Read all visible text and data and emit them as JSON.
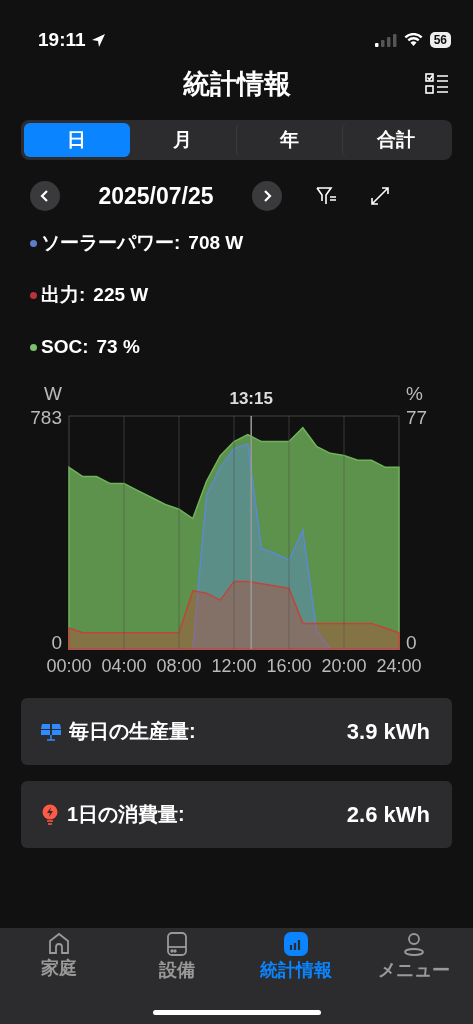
{
  "status_bar": {
    "time": "19:11",
    "battery": "56"
  },
  "header": {
    "title": "統計情報"
  },
  "period_tabs": [
    {
      "label": "日",
      "selected": true
    },
    {
      "label": "月",
      "selected": false
    },
    {
      "label": "年",
      "selected": false
    },
    {
      "label": "合計",
      "selected": false
    }
  ],
  "date_nav": {
    "date": "2025/07/25"
  },
  "legend": [
    {
      "label": "ソーラーパワー:",
      "value": "708 W",
      "color": "#5b7fc7"
    },
    {
      "label": "出力:",
      "value": "225 W",
      "color": "#b5333a"
    },
    {
      "label": "SOC:",
      "value": "73 %",
      "color": "#7cc26a"
    }
  ],
  "chart": {
    "cursor_label": "13:15",
    "left_unit": "W",
    "right_unit": "%",
    "left_ticks": [
      "783",
      "0"
    ],
    "right_ticks": [
      "77",
      "0"
    ],
    "x_labels": [
      "00:00",
      "04:00",
      "08:00",
      "12:00",
      "16:00",
      "20:00",
      "24:00"
    ]
  },
  "summary": [
    {
      "kind": "production",
      "label": "毎日の生産量:",
      "value": "3.9 kWh"
    },
    {
      "kind": "consumption",
      "label": "1日の消費量:",
      "value": "2.6 kWh"
    }
  ],
  "tab_bar": [
    {
      "kind": "home",
      "label": "家庭",
      "selected": false
    },
    {
      "kind": "device",
      "label": "設備",
      "selected": false
    },
    {
      "kind": "stats",
      "label": "統計情報",
      "selected": true
    },
    {
      "kind": "menu",
      "label": "メニュー",
      "selected": false
    }
  ]
}
